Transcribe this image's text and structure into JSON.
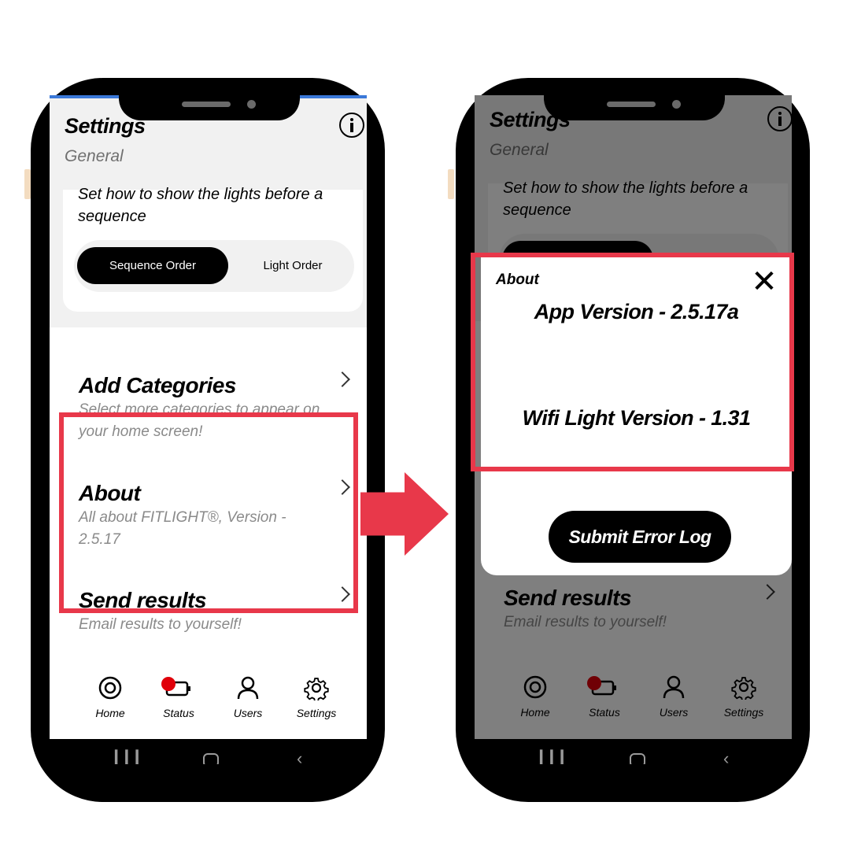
{
  "settings_screen": {
    "title": "Settings",
    "subtitle": "General",
    "light_sequence_description": "Set how to show the lights before a sequence",
    "toggle": {
      "sequence_order_label": "Sequence Order",
      "light_order_label": "Light Order",
      "selected": "Sequence Order"
    },
    "rows": [
      {
        "title": "Add Categories",
        "subtitle": "Select more categories to appear on your home screen!"
      },
      {
        "title": "About",
        "subtitle": "All about FITLIGHT®, Version - 2.5.17"
      },
      {
        "title": "Send results",
        "subtitle": "Email results to yourself!"
      }
    ]
  },
  "tabbar": {
    "tabs": [
      {
        "label": "Home",
        "icon": "target-icon"
      },
      {
        "label": "Status",
        "icon": "battery-icon"
      },
      {
        "label": "Users",
        "icon": "user-icon"
      },
      {
        "label": "Settings",
        "icon": "gear-icon"
      }
    ]
  },
  "about_modal": {
    "heading": "About",
    "app_version": "App Version - 2.5.17a",
    "wifi_light_version": "Wifi Light Version - 1.31",
    "submit_label": "Submit Error Log"
  },
  "colors": {
    "highlight": "#e8384a",
    "accent": "#3a78d8",
    "status_dot": "#e0000a"
  }
}
